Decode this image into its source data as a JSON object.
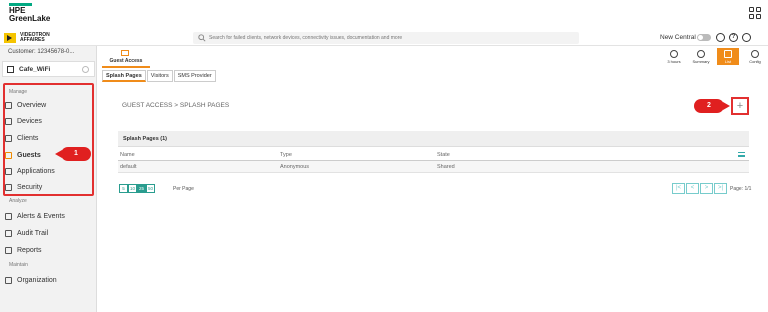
{
  "top": {
    "logo_line1": "HPE",
    "logo_line2": "GreenLake"
  },
  "app": {
    "brand_line1": "VIDEOTRON",
    "brand_line2": "AFFAIRES",
    "search_placeholder": "Search for failed clients, network devices, connectivity issues, documentation and more",
    "new_central_label": "New Central"
  },
  "sidebar": {
    "customer": "Customer: 12345678-0...",
    "group": "Cafe_WiFi",
    "manage_label": "Manage",
    "manage_items": [
      {
        "label": "Overview"
      },
      {
        "label": "Devices"
      },
      {
        "label": "Clients"
      },
      {
        "label": "Guests"
      },
      {
        "label": "Applications"
      },
      {
        "label": "Security"
      }
    ],
    "analyze_label": "Analyze",
    "analyze_items": [
      {
        "label": "Alerts & Events"
      },
      {
        "label": "Audit Trail"
      },
      {
        "label": "Reports"
      }
    ],
    "maintain_label": "Maintain",
    "maintain_items": [
      {
        "label": "Organization"
      }
    ]
  },
  "toolbar": {
    "hours": "3 hours",
    "summary": "Summary",
    "list": "List",
    "config": "Config"
  },
  "main": {
    "tab": "Guest Access",
    "subtabs": [
      "Splash Pages",
      "Visitors",
      "SMS Provider"
    ],
    "breadcrumb": "GUEST ACCESS > SPLASH PAGES",
    "add": "+",
    "panel_title": "Splash Pages (1)",
    "columns": [
      "Name",
      "Type",
      "State"
    ],
    "rows": [
      [
        "default",
        "Anonymous",
        "Shared"
      ]
    ],
    "page_sizes": [
      "5",
      "10",
      "25",
      "50"
    ],
    "per_page": "Per Page",
    "pager": [
      "|<",
      "<",
      ">",
      ">|"
    ],
    "page_info": "Page: 1/1"
  },
  "callouts": {
    "one": "1",
    "two": "2"
  },
  "colors": {
    "accent": "#f08c1a",
    "highlight": "#e23030",
    "teal": "#2a9d8f"
  }
}
